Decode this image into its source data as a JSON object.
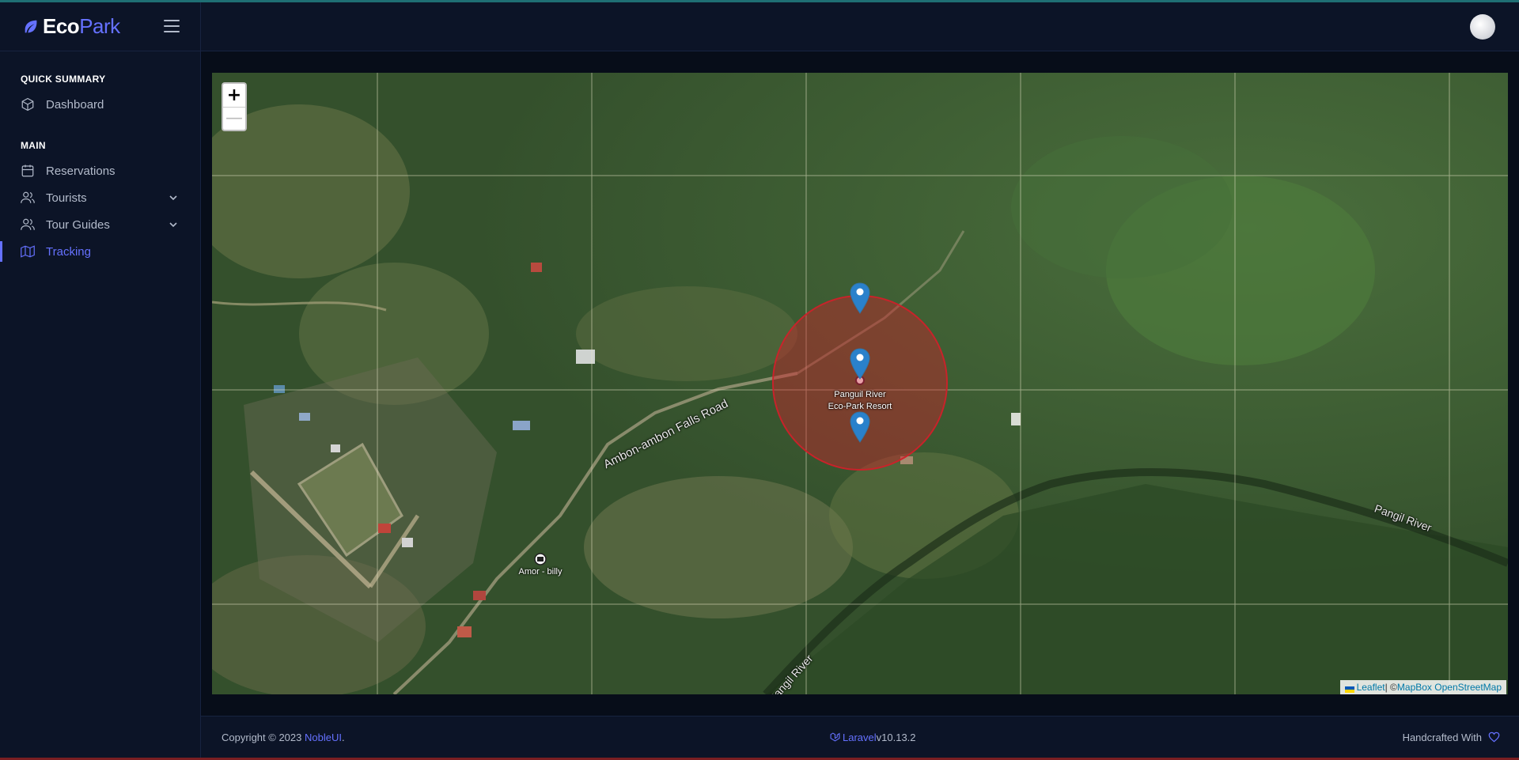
{
  "brand": {
    "eco": "Eco",
    "park": "Park"
  },
  "sidebar": {
    "categories": {
      "quick_summary": "QUICK SUMMARY",
      "main": "MAIN"
    },
    "items": [
      {
        "label": "Dashboard",
        "icon": "box-icon"
      },
      {
        "label": "Reservations",
        "icon": "calendar-icon"
      },
      {
        "label": "Tourists",
        "icon": "users-icon",
        "expandable": true
      },
      {
        "label": "Tour Guides",
        "icon": "users-icon",
        "expandable": true
      },
      {
        "label": "Tracking",
        "icon": "map-icon",
        "active": true
      }
    ]
  },
  "map": {
    "zoom_in": "+",
    "zoom_out": "—",
    "place_label_line1": "Panguil River",
    "place_label_line2": "Eco-Park Resort",
    "road_label": "Ambon-ambon Falls Road",
    "river_label_1": "Pangil River",
    "river_label_2": "Pangil River",
    "poi_label": "Amor - billy",
    "geofence_color": "#d0202a",
    "marker_color": "#2a81cb",
    "attribution": {
      "leaflet": "Leaflet",
      "separator": " | © ",
      "mapbox": "MapBox",
      "osm": "OpenStreetMap"
    }
  },
  "footer": {
    "copyright": "Copyright © 2023 ",
    "company": "NobleUI",
    "period": ".",
    "framework": "Laravel",
    "version": " v10.13.2",
    "handcrafted": "Handcrafted With"
  },
  "colors": {
    "accent": "#6571ff",
    "sidebar_bg": "#0c1427",
    "page_bg": "#070d19"
  }
}
